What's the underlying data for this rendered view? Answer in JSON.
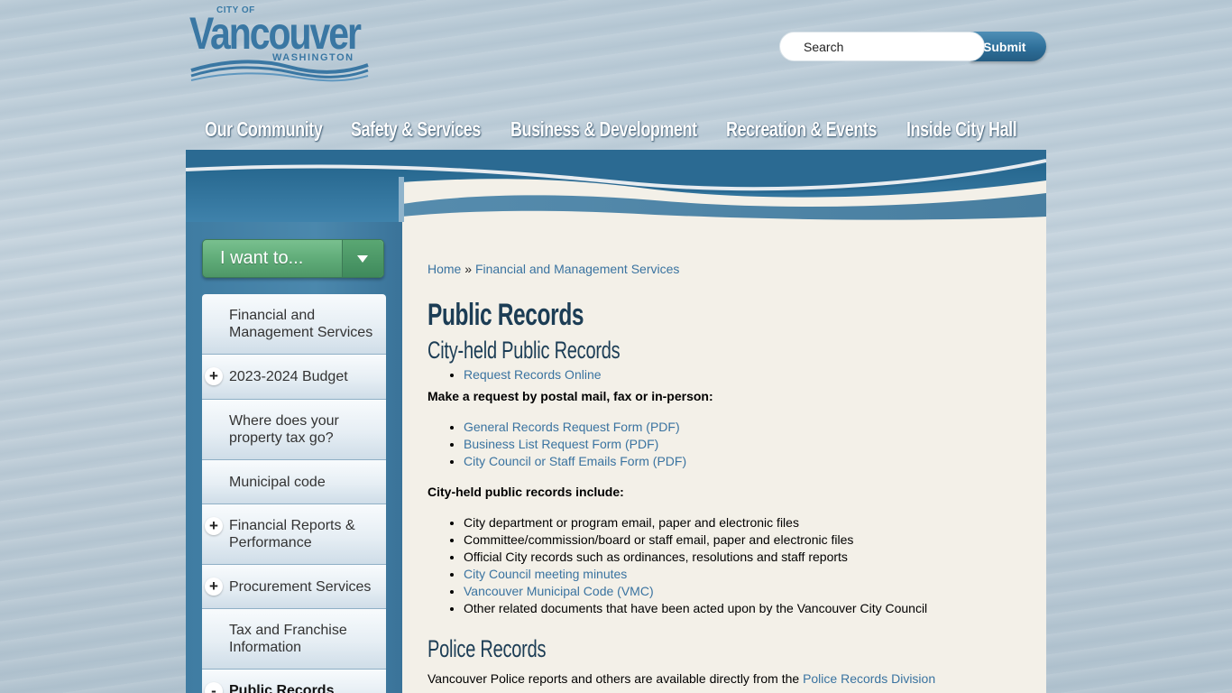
{
  "logo": {
    "city_of": "CITY OF",
    "name": "Vancouver",
    "state": "WASHINGTON"
  },
  "search": {
    "placeholder": "Search",
    "submit_label": "Submit"
  },
  "topnav": [
    "Our Community",
    "Safety & Services",
    "Business & Development",
    "Recreation & Events",
    "Inside City Hall"
  ],
  "iwant": {
    "label": "I want to..."
  },
  "sidebar": {
    "items": [
      {
        "label": "Financial and Management Services",
        "expander": ""
      },
      {
        "label": "2023-2024 Budget",
        "expander": "+"
      },
      {
        "label": "Where does your property tax go?",
        "expander": ""
      },
      {
        "label": "Municipal code",
        "expander": ""
      },
      {
        "label": "Financial Reports & Performance",
        "expander": "+"
      },
      {
        "label": "Procurement Services",
        "expander": "+"
      },
      {
        "label": "Tax and Franchise Information",
        "expander": ""
      },
      {
        "label": "Public Records",
        "expander": "-"
      }
    ]
  },
  "breadcrumb": {
    "home": "Home",
    "sep": "»",
    "parent": "Financial and Management Services"
  },
  "main": {
    "title": "Public Records",
    "section1_heading": "City-held Public Records",
    "online_link": "Request Records Online",
    "mail_lead": "Make a request by postal mail, fax or in-person:",
    "forms": [
      "General Records Request Form (PDF)",
      "Business List Request Form (PDF)",
      "City Council or Staff Emails Form (PDF)"
    ],
    "include_lead": "City-held public records include:",
    "includes": [
      {
        "text": "City department or program email, paper and electronic files",
        "link": false
      },
      {
        "text": "Committee/commission/board or staff email, paper and electronic files",
        "link": false
      },
      {
        "text": "Official City records such as ordinances, resolutions and staff reports",
        "link": false
      },
      {
        "text": "City Council meeting minutes",
        "link": true
      },
      {
        "text": "Vancouver Municipal Code (VMC)",
        "link": true
      },
      {
        "text": "Other related documents that have been acted upon by the Vancouver City Council",
        "link": false
      }
    ],
    "section2_heading": "Police Records",
    "police_text": "Vancouver Police reports and others are available directly from the ",
    "police_link": "Police Records Division"
  },
  "colors": {
    "link": "#3a73a0",
    "heading": "#1c3d55",
    "sidebar": "#4b88ad",
    "iwant": "#5eaa77",
    "content_bg": "#f3f0e8"
  }
}
